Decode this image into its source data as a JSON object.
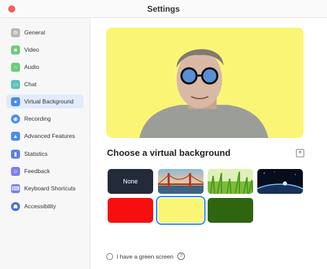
{
  "window": {
    "title": "Settings"
  },
  "sidebar": {
    "items": [
      {
        "label": "General",
        "icon": "gear-icon",
        "color": "#b6b6b6"
      },
      {
        "label": "Video",
        "icon": "video-icon",
        "color": "#6ccc7a"
      },
      {
        "label": "Audio",
        "icon": "headphones-icon",
        "color": "#6ccc7a"
      },
      {
        "label": "Chat",
        "icon": "chat-icon",
        "color": "#5cc0b9"
      },
      {
        "label": "Virtual Background",
        "icon": "person-icon",
        "color": "#4a8af4"
      },
      {
        "label": "Recording",
        "icon": "record-icon",
        "color": "#4a8af4"
      },
      {
        "label": "Advanced Features",
        "icon": "shapes-icon",
        "color": "#4a8af4"
      },
      {
        "label": "Statistics",
        "icon": "stats-icon",
        "color": "#5c7ef0"
      },
      {
        "label": "Feedback",
        "icon": "feedback-icon",
        "color": "#7b7ff0"
      },
      {
        "label": "Keyboard Shortcuts",
        "icon": "keyboard-icon",
        "color": "#7b7ff0"
      },
      {
        "label": "Accessibility",
        "icon": "accessibility-icon",
        "color": "#4a6fd8"
      }
    ],
    "active_index": 4
  },
  "main": {
    "section_title": "Choose a virtual background",
    "add_icon": "plus-icon",
    "backgrounds": [
      {
        "label": "None",
        "kind": "none"
      },
      {
        "label": "",
        "kind": "golden-gate-bridge"
      },
      {
        "label": "",
        "kind": "grass"
      },
      {
        "label": "",
        "kind": "earth-from-space"
      },
      {
        "label": "",
        "kind": "solid",
        "color": "#f70f0f"
      },
      {
        "label": "",
        "kind": "solid",
        "color": "#fbf576",
        "selected": true
      },
      {
        "label": "",
        "kind": "solid",
        "color": "#2f6410"
      }
    ],
    "green_screen_label": "I have a green screen",
    "green_screen_checked": false
  },
  "colors": {
    "accent": "#2d8cff",
    "preview_background": "#fbf576"
  }
}
